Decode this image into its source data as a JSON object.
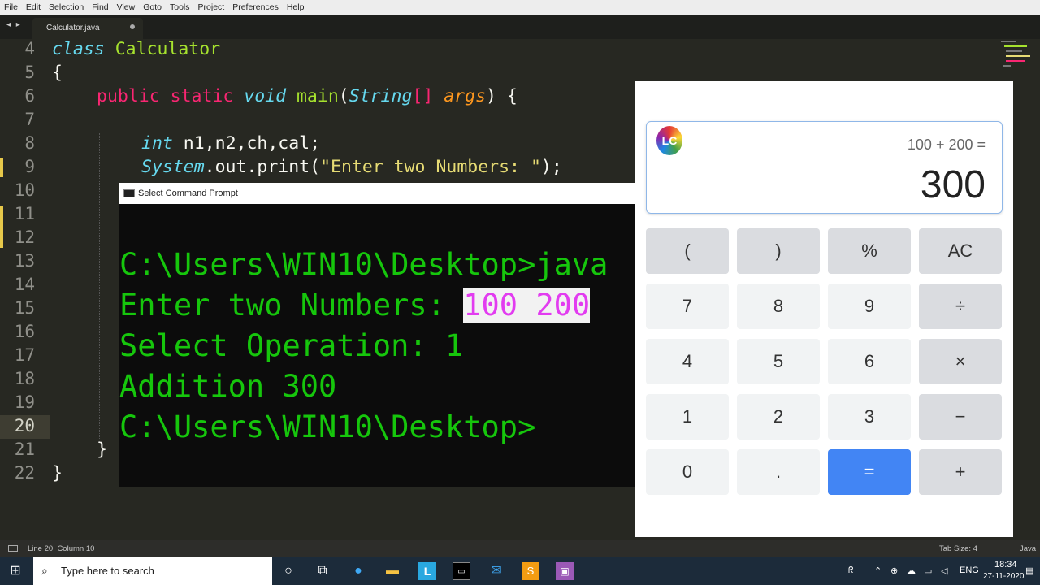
{
  "menu": [
    "File",
    "Edit",
    "Selection",
    "Find",
    "View",
    "Goto",
    "Tools",
    "Project",
    "Preferences",
    "Help"
  ],
  "tab": {
    "arrows": "◂ ▸",
    "filename": "Calculator.java"
  },
  "editor": {
    "line_numbers": [
      "4",
      "5",
      "6",
      "7",
      "8",
      "9",
      "10",
      "11",
      "12",
      "13",
      "14",
      "15",
      "16",
      "17",
      "18",
      "19",
      "20",
      "21",
      "22"
    ],
    "current_line": "20",
    "code": {
      "l4_kw": "class",
      "l4_name": "Calculator",
      "l5": "{",
      "l6_public": "public",
      "l6_static": "static",
      "l6_void": "void",
      "l6_main": "main",
      "l6_paren": "(",
      "l6_type": "String",
      "l6_br": "[]",
      "l6_args": "args",
      "l6_end": ") {",
      "l8_int": "int",
      "l8_rest": "n1,n2,ch,cal;",
      "l9_sys": "System",
      "l9_mid": ".out.print(",
      "l9_str": "\"Enter two Numbers: \"",
      "l9_end": ");",
      "l21": "}",
      "l22": "}"
    }
  },
  "cmd": {
    "title": "Select Command Prompt",
    "line1": "C:\\Users\\WIN10\\Desktop>java",
    "line2_prefix": "Enter two Numbers: ",
    "line2_input": "100 200",
    "line3": "Select Operation: 1",
    "line4": "Addition 300",
    "line5": "C:\\Users\\WIN10\\Desktop>"
  },
  "calculator": {
    "logo": "LC",
    "expression": "100 + 200 =",
    "result": "300",
    "keys": [
      [
        "(",
        ")",
        "%",
        "AC"
      ],
      [
        "7",
        "8",
        "9",
        "÷"
      ],
      [
        "4",
        "5",
        "6",
        "×"
      ],
      [
        "1",
        "2",
        "3",
        "−"
      ],
      [
        "0",
        ".",
        "=",
        "+"
      ]
    ],
    "accent": "#4285f4"
  },
  "status": {
    "position": "Line 20, Column 10",
    "tab_size": "Tab Size: 4",
    "syntax": "Java"
  },
  "taskbar": {
    "search_placeholder": "Type here to search",
    "language": "ENG",
    "time": "18:34",
    "date": "27-11-2020"
  }
}
